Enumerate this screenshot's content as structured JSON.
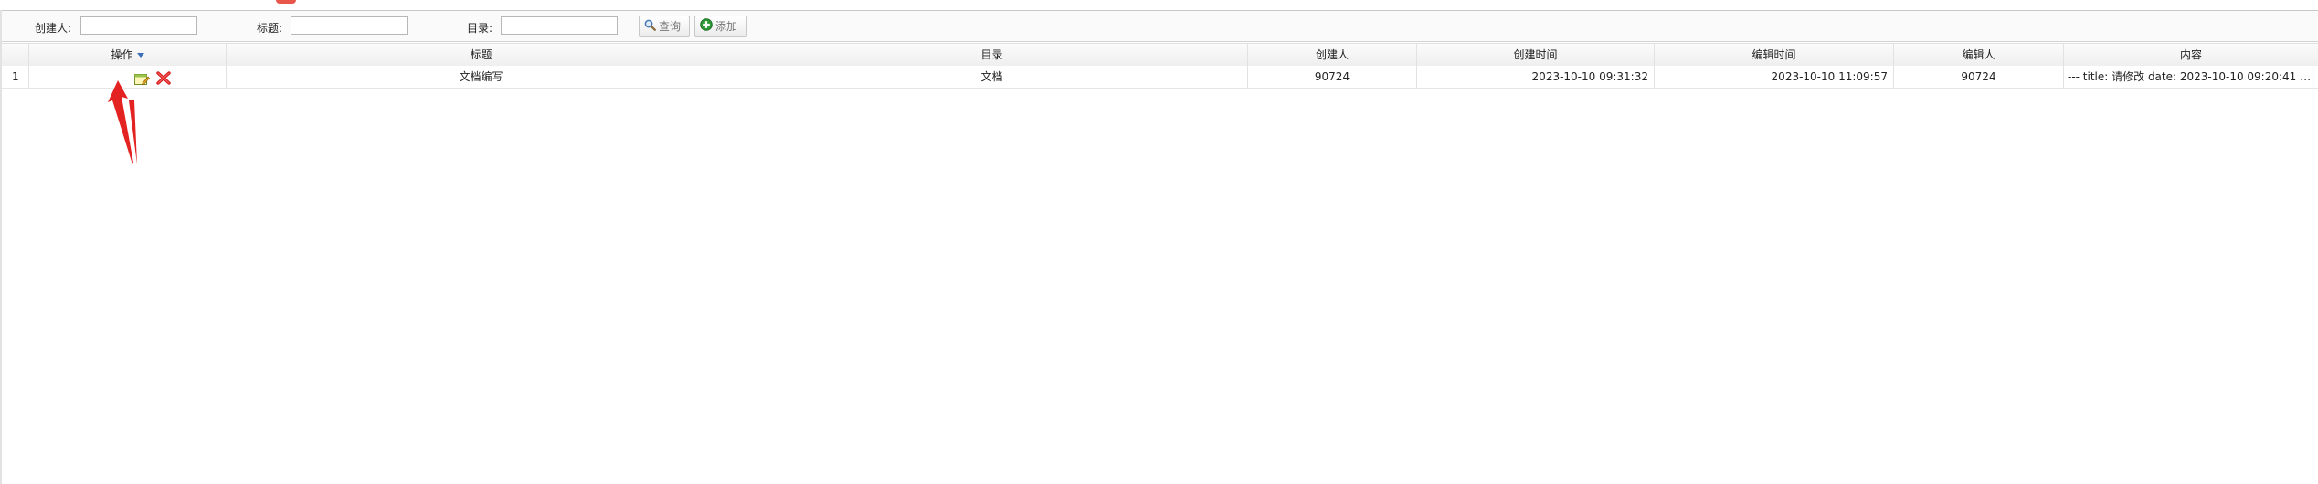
{
  "filters": {
    "creator_label": "创建人:",
    "title_label": "标题:",
    "dir_label": "目录:",
    "creator_value": "",
    "title_value": "",
    "dir_value": ""
  },
  "buttons": {
    "search_label": "查询",
    "add_label": "添加"
  },
  "grid": {
    "columns": [
      "操作",
      "标题",
      "目录",
      "创建人",
      "创建时间",
      "编辑时间",
      "编辑人",
      "内容"
    ],
    "rows": [
      {
        "index": "1",
        "title": "文档编写",
        "dir": "文档",
        "creator": "90724",
        "created": "2023-10-10 09:31:32",
        "edited": "2023-10-10 11:09:57",
        "editor": "90724",
        "content": "--- title: 请修改 date: 2023-10-10 09:20:41 perm..."
      }
    ]
  },
  "colors": {
    "accent_arrow": "#e32222",
    "header_bg": "#efefef",
    "sort_arrow": "#3b6fb6"
  },
  "icons": {
    "search": "magnifier-icon",
    "add": "plus-circle-icon",
    "edit": "edit-icon",
    "delete": "delete-icon"
  }
}
